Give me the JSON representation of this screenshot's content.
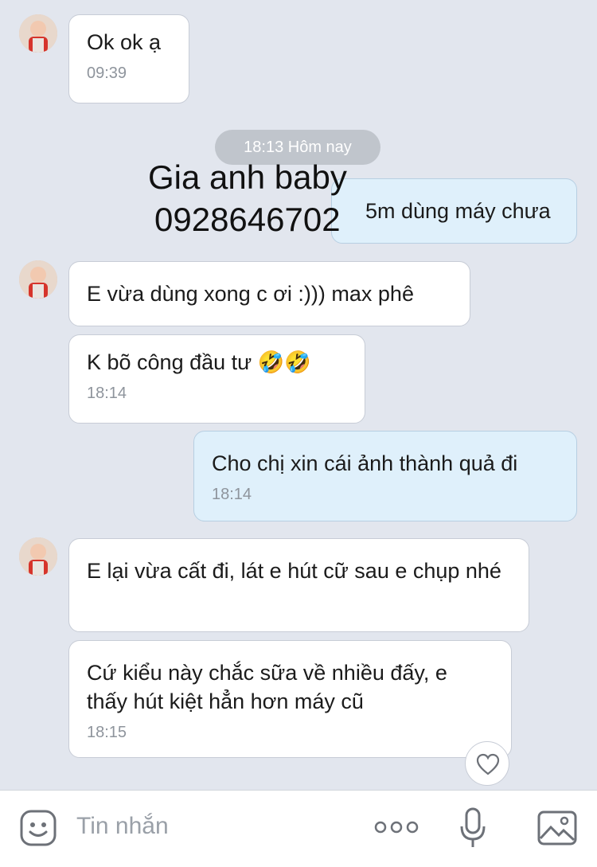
{
  "timestamp_separator": "18:13 Hôm nay",
  "watermark": {
    "line1": "Gia anh baby",
    "line2": "0928646702"
  },
  "messages": [
    {
      "text": "Ok ok ạ",
      "time": "09:39"
    },
    {
      "text": "5m dùng máy chưa"
    },
    {
      "text": "E vừa dùng xong c ơi :))) max phê"
    },
    {
      "text": "K bõ công đầu tư 🤣🤣",
      "time": "18:14"
    },
    {
      "text": "Cho chị xin cái ảnh thành quả đi",
      "time": "18:14"
    },
    {
      "text": "E lại vừa cất đi, lát e hút cữ sau e chụp nhé"
    },
    {
      "text": "Cứ kiểu này chắc sữa về nhiều đấy, e thấy hút kiệt hẳn hơn máy cũ",
      "time": "18:15"
    }
  ],
  "input": {
    "placeholder": "Tin nhắn"
  },
  "icons": {
    "sticker": "smiley-icon",
    "more": "more-dots-icon",
    "mic": "microphone-icon",
    "image": "image-icon",
    "react": "heart-icon"
  }
}
